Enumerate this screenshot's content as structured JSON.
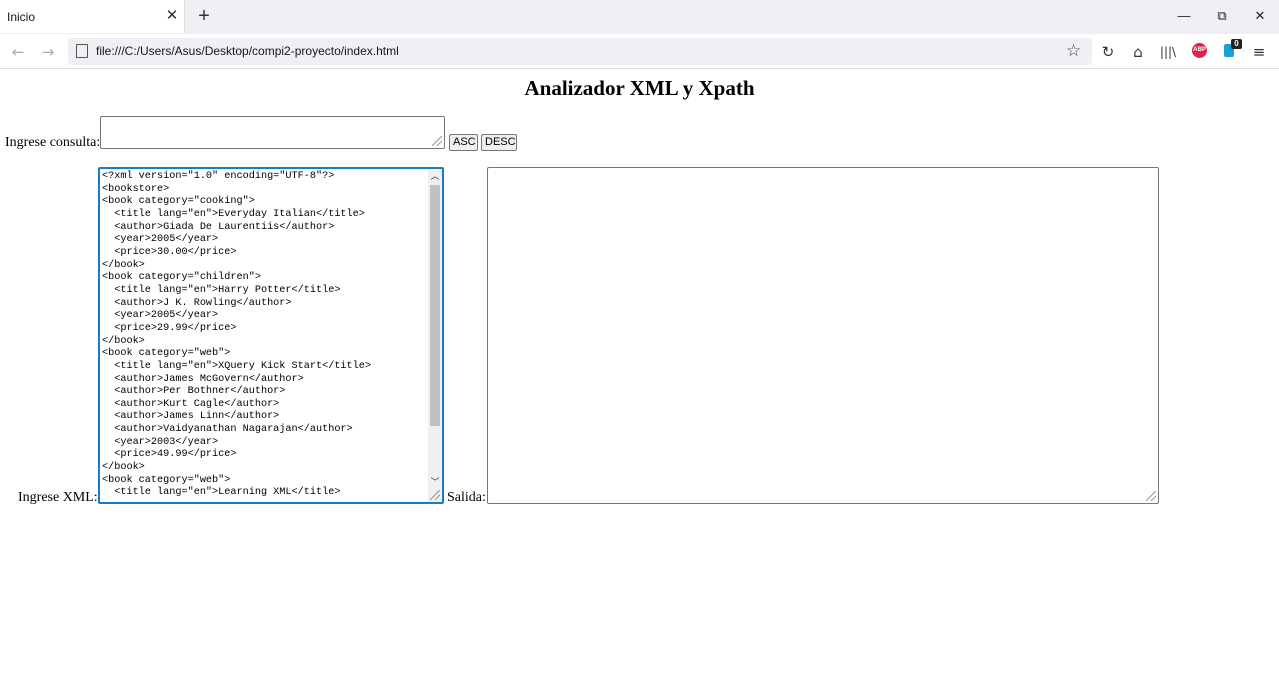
{
  "browser": {
    "tab_title": "Inicio",
    "tab_close": "✕",
    "new_tab": "+",
    "url": "file:///C:/Users/Asus/Desktop/compi2-proyecto/index.html",
    "abp_label": "ABP",
    "ext_badge": "0",
    "window": {
      "minimize": "—",
      "restore": "⧉",
      "close": "✕"
    }
  },
  "page": {
    "title": "Analizador XML y Xpath",
    "query_label": "Ingrese consulta:",
    "query_value": "",
    "asc_label": "ASC",
    "desc_label": "DESC",
    "xml_label": "Ingrese XML:",
    "xml_value": "<?xml version=\"1.0\" encoding=\"UTF-8\"?>\n<bookstore>\n<book category=\"cooking\">\n  <title lang=\"en\">Everyday Italian</title>\n  <author>Giada De Laurentiis</author>\n  <year>2005</year>\n  <price>30.00</price>\n</book>\n<book category=\"children\">\n  <title lang=\"en\">Harry Potter</title>\n  <author>J K. Rowling</author>\n  <year>2005</year>\n  <price>29.99</price>\n</book>\n<book category=\"web\">\n  <title lang=\"en\">XQuery Kick Start</title>\n  <author>James McGovern</author>\n  <author>Per Bothner</author>\n  <author>Kurt Cagle</author>\n  <author>James Linn</author>\n  <author>Vaidyanathan Nagarajan</author>\n  <year>2003</year>\n  <price>49.99</price>\n</book>\n<book category=\"web\">\n  <title lang=\"en\">Learning XML</title>",
    "output_label": "Salida:",
    "output_value": ""
  }
}
